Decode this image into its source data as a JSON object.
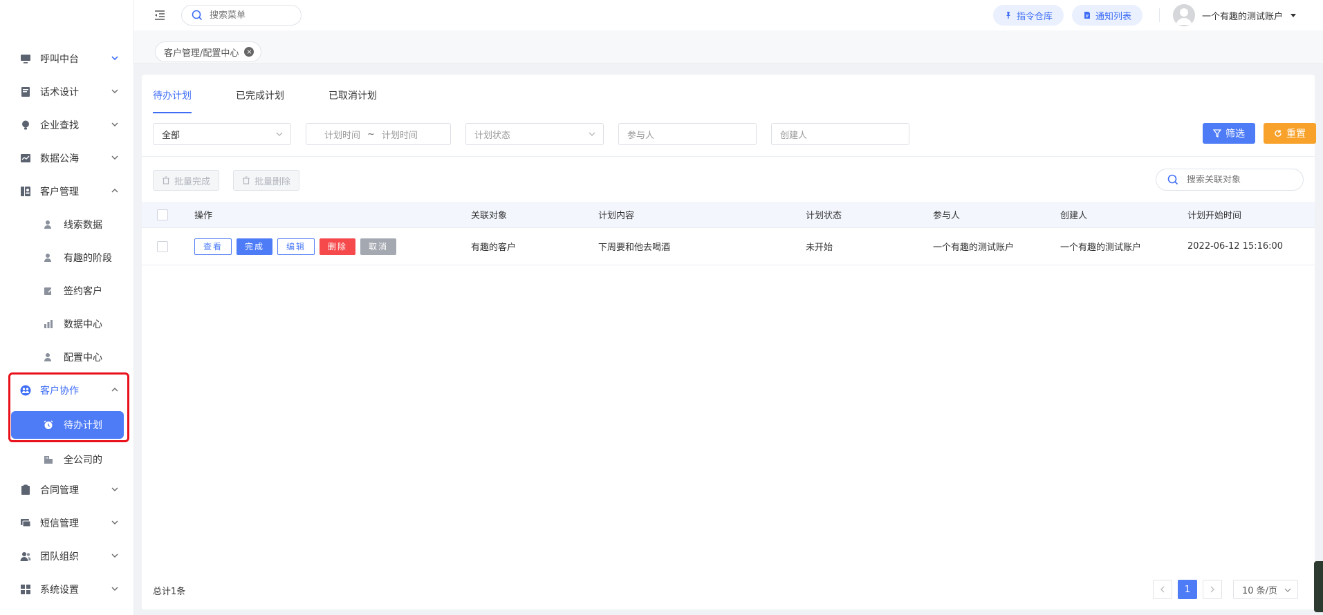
{
  "sidebar": {
    "items": [
      {
        "label": "呼叫中台",
        "icon": "monitor-icon"
      },
      {
        "label": "话术设计",
        "icon": "book-icon"
      },
      {
        "label": "企业查找",
        "icon": "bulb-icon"
      },
      {
        "label": "数据公海",
        "icon": "chart-icon"
      },
      {
        "label": "客户管理",
        "icon": "contact-icon"
      },
      {
        "label": "客户协作",
        "icon": "team-icon"
      },
      {
        "label": "合同管理",
        "icon": "clipboard-icon"
      },
      {
        "label": "短信管理",
        "icon": "message-icon"
      },
      {
        "label": "团队组织",
        "icon": "users-icon"
      },
      {
        "label": "系统设置",
        "icon": "grid-icon"
      }
    ],
    "customer_sub": [
      {
        "label": "线索数据",
        "icon": "user-search-icon"
      },
      {
        "label": "有趣的阶段",
        "icon": "user-stage-icon"
      },
      {
        "label": "签约客户",
        "icon": "sign-icon"
      },
      {
        "label": "数据中心",
        "icon": "bar-icon"
      },
      {
        "label": "配置中心",
        "icon": "user-gear-icon"
      }
    ],
    "collab_sub": [
      {
        "label": "待办计划",
        "icon": "alarm-icon"
      },
      {
        "label": "全公司的",
        "icon": "building-icon"
      }
    ]
  },
  "header": {
    "search_placeholder": "搜索菜单",
    "cmd_btn": "指令仓库",
    "notice_btn": "通知列表",
    "username": "一个有趣的测试账户"
  },
  "tagbar": {
    "tag": "客户管理/配置中心"
  },
  "tabs": [
    {
      "label": "待办计划"
    },
    {
      "label": "已完成计划"
    },
    {
      "label": "已取消计划"
    }
  ],
  "filters": {
    "scope": "全部",
    "start_placeholder": "计划时间",
    "range_sep": "~",
    "end_placeholder": "计划时间",
    "status_placeholder": "计划状态",
    "participant_placeholder": "参与人",
    "creator_placeholder": "创建人",
    "filter_btn": "筛选",
    "reset_btn": "重置"
  },
  "toolbar": {
    "batch_done": "批量完成",
    "batch_delete": "批量删除",
    "search_placeholder": "搜索关联对象"
  },
  "table": {
    "headers": {
      "ops": "操作",
      "target": "关联对象",
      "content": "计划内容",
      "status": "计划状态",
      "participant": "参与人",
      "creator": "创建人",
      "start": "计划开始时间"
    },
    "op_labels": {
      "view": "查看",
      "done": "完成",
      "edit": "编辑",
      "delete": "删除",
      "cancel": "取消"
    },
    "rows": [
      {
        "target": "有趣的客户",
        "content": "下周要和他去喝酒",
        "status": "未开始",
        "participant": "一个有趣的测试账户",
        "creator": "一个有趣的测试账户",
        "start": "2022-06-12 15:16:00"
      }
    ]
  },
  "footer": {
    "total": "总计1条",
    "current_page": "1",
    "page_size": "10 条/页"
  },
  "colors": {
    "primary": "#4e7cf6",
    "warning": "#f8a22b",
    "danger": "#f5494b",
    "highlight": "#e8101a"
  }
}
